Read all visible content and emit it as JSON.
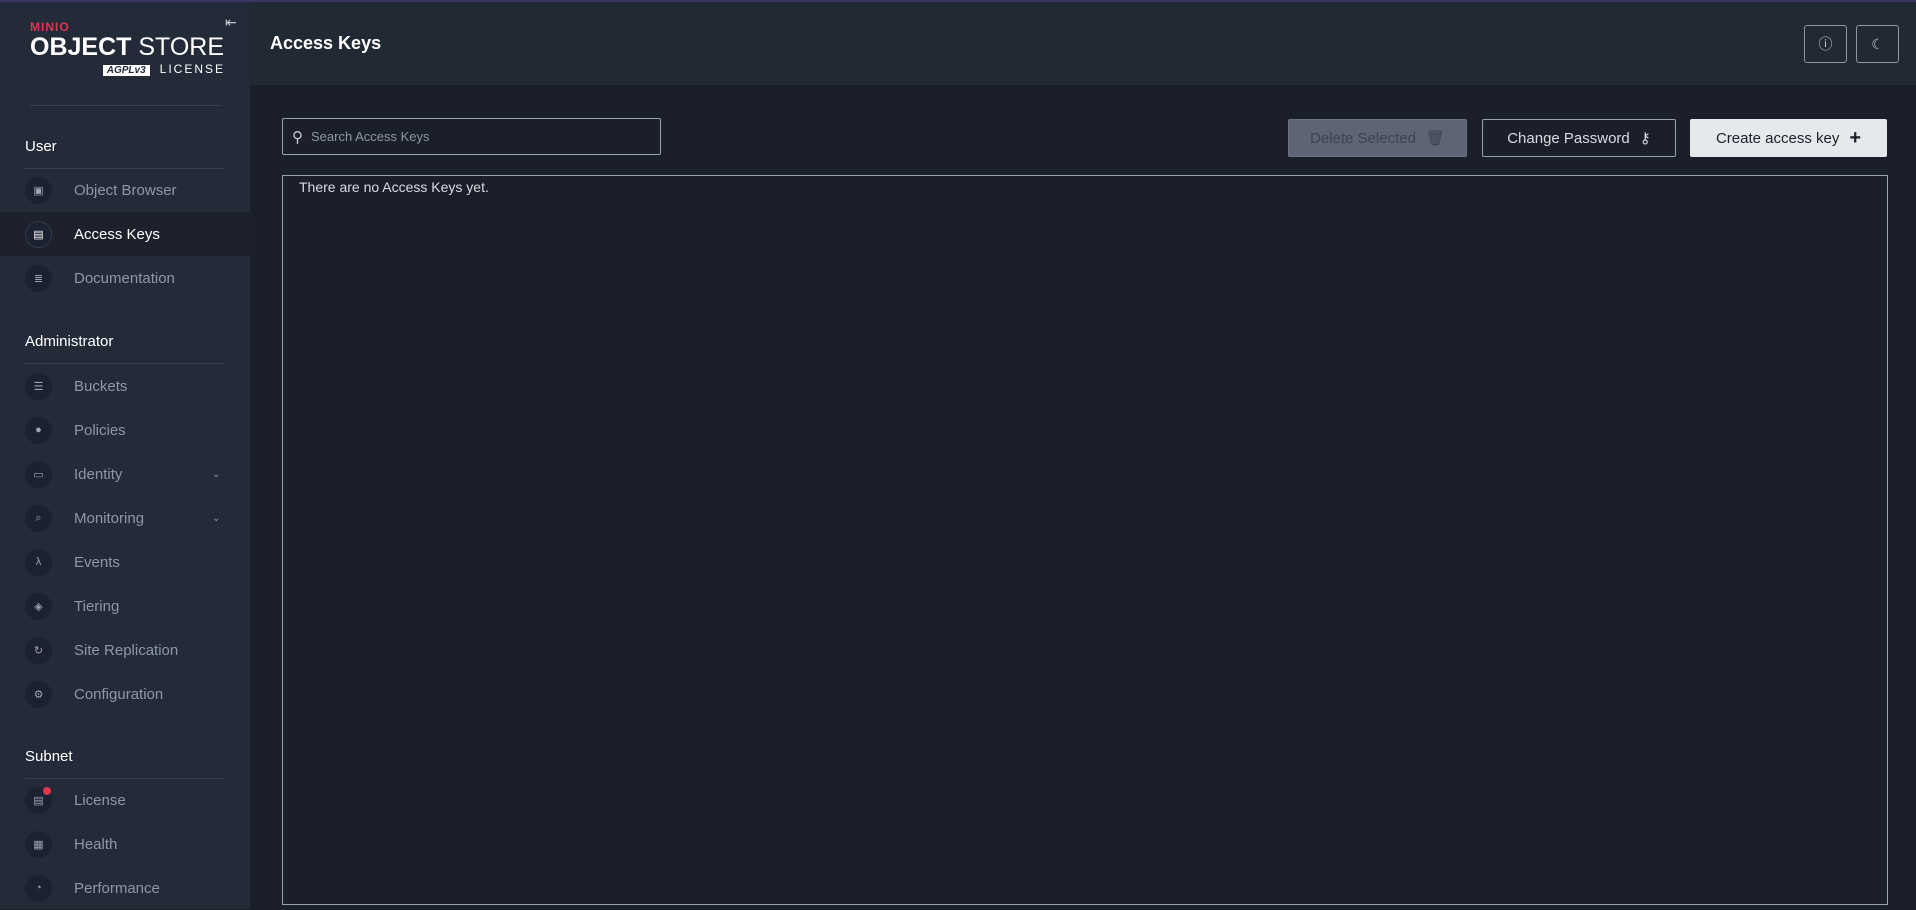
{
  "logo": {
    "brand": "MINIO",
    "product_bold": "OBJECT",
    "product_light": "STORE",
    "license_badge": "AGPLv3",
    "license": "LICENSE"
  },
  "sidebar": {
    "sections": [
      {
        "label": "User",
        "items": [
          {
            "label": "Object Browser",
            "icon": "object-browser-icon"
          },
          {
            "label": "Access Keys",
            "icon": "access-keys-icon",
            "active": true
          },
          {
            "label": "Documentation",
            "icon": "documentation-icon"
          }
        ]
      },
      {
        "label": "Administrator",
        "items": [
          {
            "label": "Buckets",
            "icon": "bucket-icon"
          },
          {
            "label": "Policies",
            "icon": "lock-icon"
          },
          {
            "label": "Identity",
            "icon": "identity-icon",
            "expandable": true
          },
          {
            "label": "Monitoring",
            "icon": "monitoring-icon",
            "expandable": true
          },
          {
            "label": "Events",
            "icon": "lambda-icon"
          },
          {
            "label": "Tiering",
            "icon": "layers-icon"
          },
          {
            "label": "Site Replication",
            "icon": "replication-icon"
          },
          {
            "label": "Configuration",
            "icon": "gear-icon"
          }
        ]
      },
      {
        "label": "Subnet",
        "items": [
          {
            "label": "License",
            "icon": "license-icon",
            "badge": true
          },
          {
            "label": "Health",
            "icon": "health-icon"
          },
          {
            "label": "Performance",
            "icon": "performance-icon"
          }
        ]
      }
    ]
  },
  "header": {
    "title": "Access Keys",
    "help_icon": "help-icon",
    "theme_icon": "moon-icon"
  },
  "toolbar": {
    "search_placeholder": "Search Access Keys",
    "search_value": "",
    "delete_label": "Delete Selected",
    "change_password_label": "Change Password",
    "create_label": "Create access key",
    "create_icon": "+"
  },
  "content": {
    "empty_message": "There are no Access Keys yet."
  },
  "colors": {
    "accent": "#e0334f",
    "sidebar": "#242b38",
    "header": "#212935",
    "background": "#1a1f29"
  }
}
